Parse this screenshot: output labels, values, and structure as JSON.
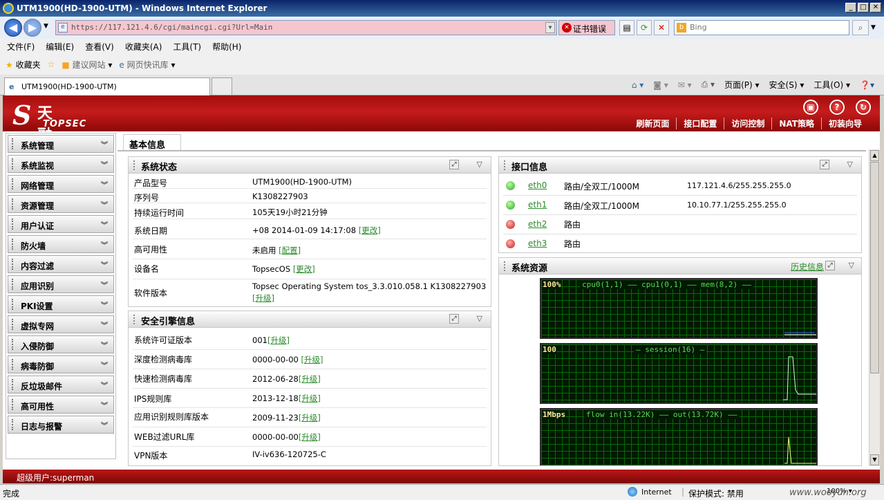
{
  "window": {
    "title": "UTM1900(HD-1900-UTM) - Windows Internet Explorer"
  },
  "browser": {
    "url": "https://117.121.4.6/cgi/maincgi.cgi?Url=Main",
    "cert_error": "证书错误",
    "search_placeholder": "Bing",
    "menu": [
      "文件(F)",
      "编辑(E)",
      "查看(V)",
      "收藏夹(A)",
      "工具(T)",
      "帮助(H)"
    ],
    "favorites": {
      "label": "收藏夹",
      "suggested": "建议网站",
      "webslice": "网页快讯库"
    },
    "tab_title": "UTM1900(HD-1900-UTM)",
    "tools": {
      "page": "页面(P)",
      "safety": "安全(S)",
      "tools": "工具(O)"
    }
  },
  "app": {
    "logo_cn": "天融信",
    "logo_en": "TOPSEC",
    "quick_nav": [
      "刷新页面",
      "接口配置",
      "访问控制",
      "NAT策略",
      "初装向导"
    ],
    "sidebar": [
      "系统管理",
      "系统监视",
      "网络管理",
      "资源管理",
      "用户认证",
      "防火墙",
      "内容过滤",
      "应用识别",
      "PKI设置",
      "虚拟专网",
      "入侵防御",
      "病毒防御",
      "反垃圾邮件",
      "高可用性",
      "日志与报警"
    ],
    "active_tab": "基本信息",
    "system_status": {
      "title": "系统状态",
      "rows": [
        {
          "key": "产品型号",
          "value": "UTM1900(HD-1900-UTM)",
          "link": ""
        },
        {
          "key": "序列号",
          "value": "K1308227903",
          "link": ""
        },
        {
          "key": "持续运行时间",
          "value": "105天19小时21分钟",
          "link": ""
        },
        {
          "key": "系统日期",
          "value": "+08 2014-01-09 14:17:08 ",
          "link": "[更改]"
        },
        {
          "key": "高可用性",
          "value": "未启用 ",
          "link": "[配置]"
        },
        {
          "key": "设备名",
          "value": "TopsecOS ",
          "link": "[更改]"
        },
        {
          "key": "软件版本",
          "value": "Topsec Operating System tos_3.3.010.058.1 K1308227903",
          "link": "[升级]"
        }
      ]
    },
    "security_engine": {
      "title": "安全引擎信息",
      "rows": [
        {
          "key": "系统许可证版本",
          "value": "001",
          "link": "[升级]"
        },
        {
          "key": "深度检测病毒库",
          "value": "0000-00-00 ",
          "link": "[升级]"
        },
        {
          "key": "快速检测病毒库",
          "value": "2012-06-28",
          "link": "[升级]"
        },
        {
          "key": "IPS规则库",
          "value": "2013-12-18",
          "link": "[升级]"
        },
        {
          "key": "应用识别规则库版本",
          "value": "2009-11-23",
          "link": "[升级]"
        },
        {
          "key": "WEB过滤URL库",
          "value": "0000-00-00",
          "link": "[升级]"
        },
        {
          "key": "VPN版本",
          "value": "IV-iv636-120725-C",
          "link": ""
        }
      ]
    },
    "interfaces": {
      "title": "接口信息",
      "rows": [
        {
          "status": "up",
          "name": "eth0",
          "mode": "路由/全双工/1000M",
          "ip": "117.121.4.6/255.255.255.0"
        },
        {
          "status": "up",
          "name": "eth1",
          "mode": "路由/全双工/1000M",
          "ip": "10.10.77.1/255.255.255.0"
        },
        {
          "status": "down",
          "name": "eth2",
          "mode": "路由",
          "ip": ""
        },
        {
          "status": "down",
          "name": "eth3",
          "mode": "路由",
          "ip": ""
        }
      ]
    },
    "resources": {
      "title": "系统资源",
      "history_link": "历史信息",
      "graphs": [
        {
          "scale": "100%",
          "legend": "cpu0(1,1) —— cpu1(0,1) —— mem(8,2) ——"
        },
        {
          "scale": "100",
          "legend": "— session(16) —"
        },
        {
          "scale": "1Mbps",
          "legend": "flow in(13.22K) ——  out(13.72K) ——"
        }
      ]
    },
    "footer_user": "超级用户:superman"
  },
  "status": {
    "text": "完成",
    "zone": "Internet",
    "protected_mode": "保护模式: 禁用",
    "zoom": "100%",
    "watermark": "www.wooyun.org"
  },
  "colors": {
    "brand_red": "#c51c1c",
    "link_green": "#2b8a2b",
    "graph_bg": "#001a00",
    "graph_grid": "#0a6a0a"
  }
}
